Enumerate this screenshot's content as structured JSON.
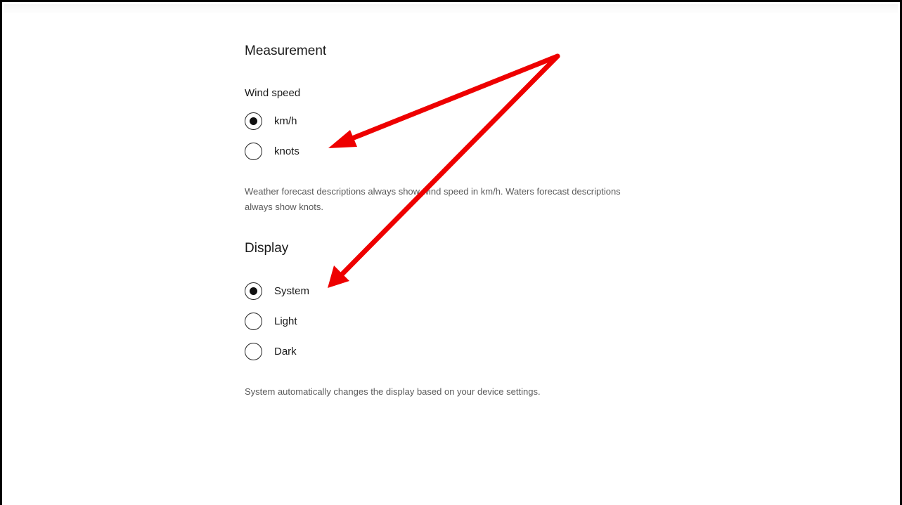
{
  "measurement": {
    "title": "Measurement",
    "wind_speed": {
      "label": "Wind speed",
      "options": [
        {
          "label": "km/h",
          "selected": true
        },
        {
          "label": "knots",
          "selected": false
        }
      ]
    },
    "note": "Weather forecast descriptions always show wind speed in km/h. Waters forecast descriptions always show knots."
  },
  "display": {
    "title": "Display",
    "options": [
      {
        "label": "System",
        "selected": true
      },
      {
        "label": "Light",
        "selected": false
      },
      {
        "label": "Dark",
        "selected": false
      }
    ],
    "note": "System automatically changes the display based on your device settings."
  },
  "colors": {
    "annotation_arrow": "#ee0000",
    "text": "#1a1a1a",
    "note_text": "#5a5a5a"
  }
}
